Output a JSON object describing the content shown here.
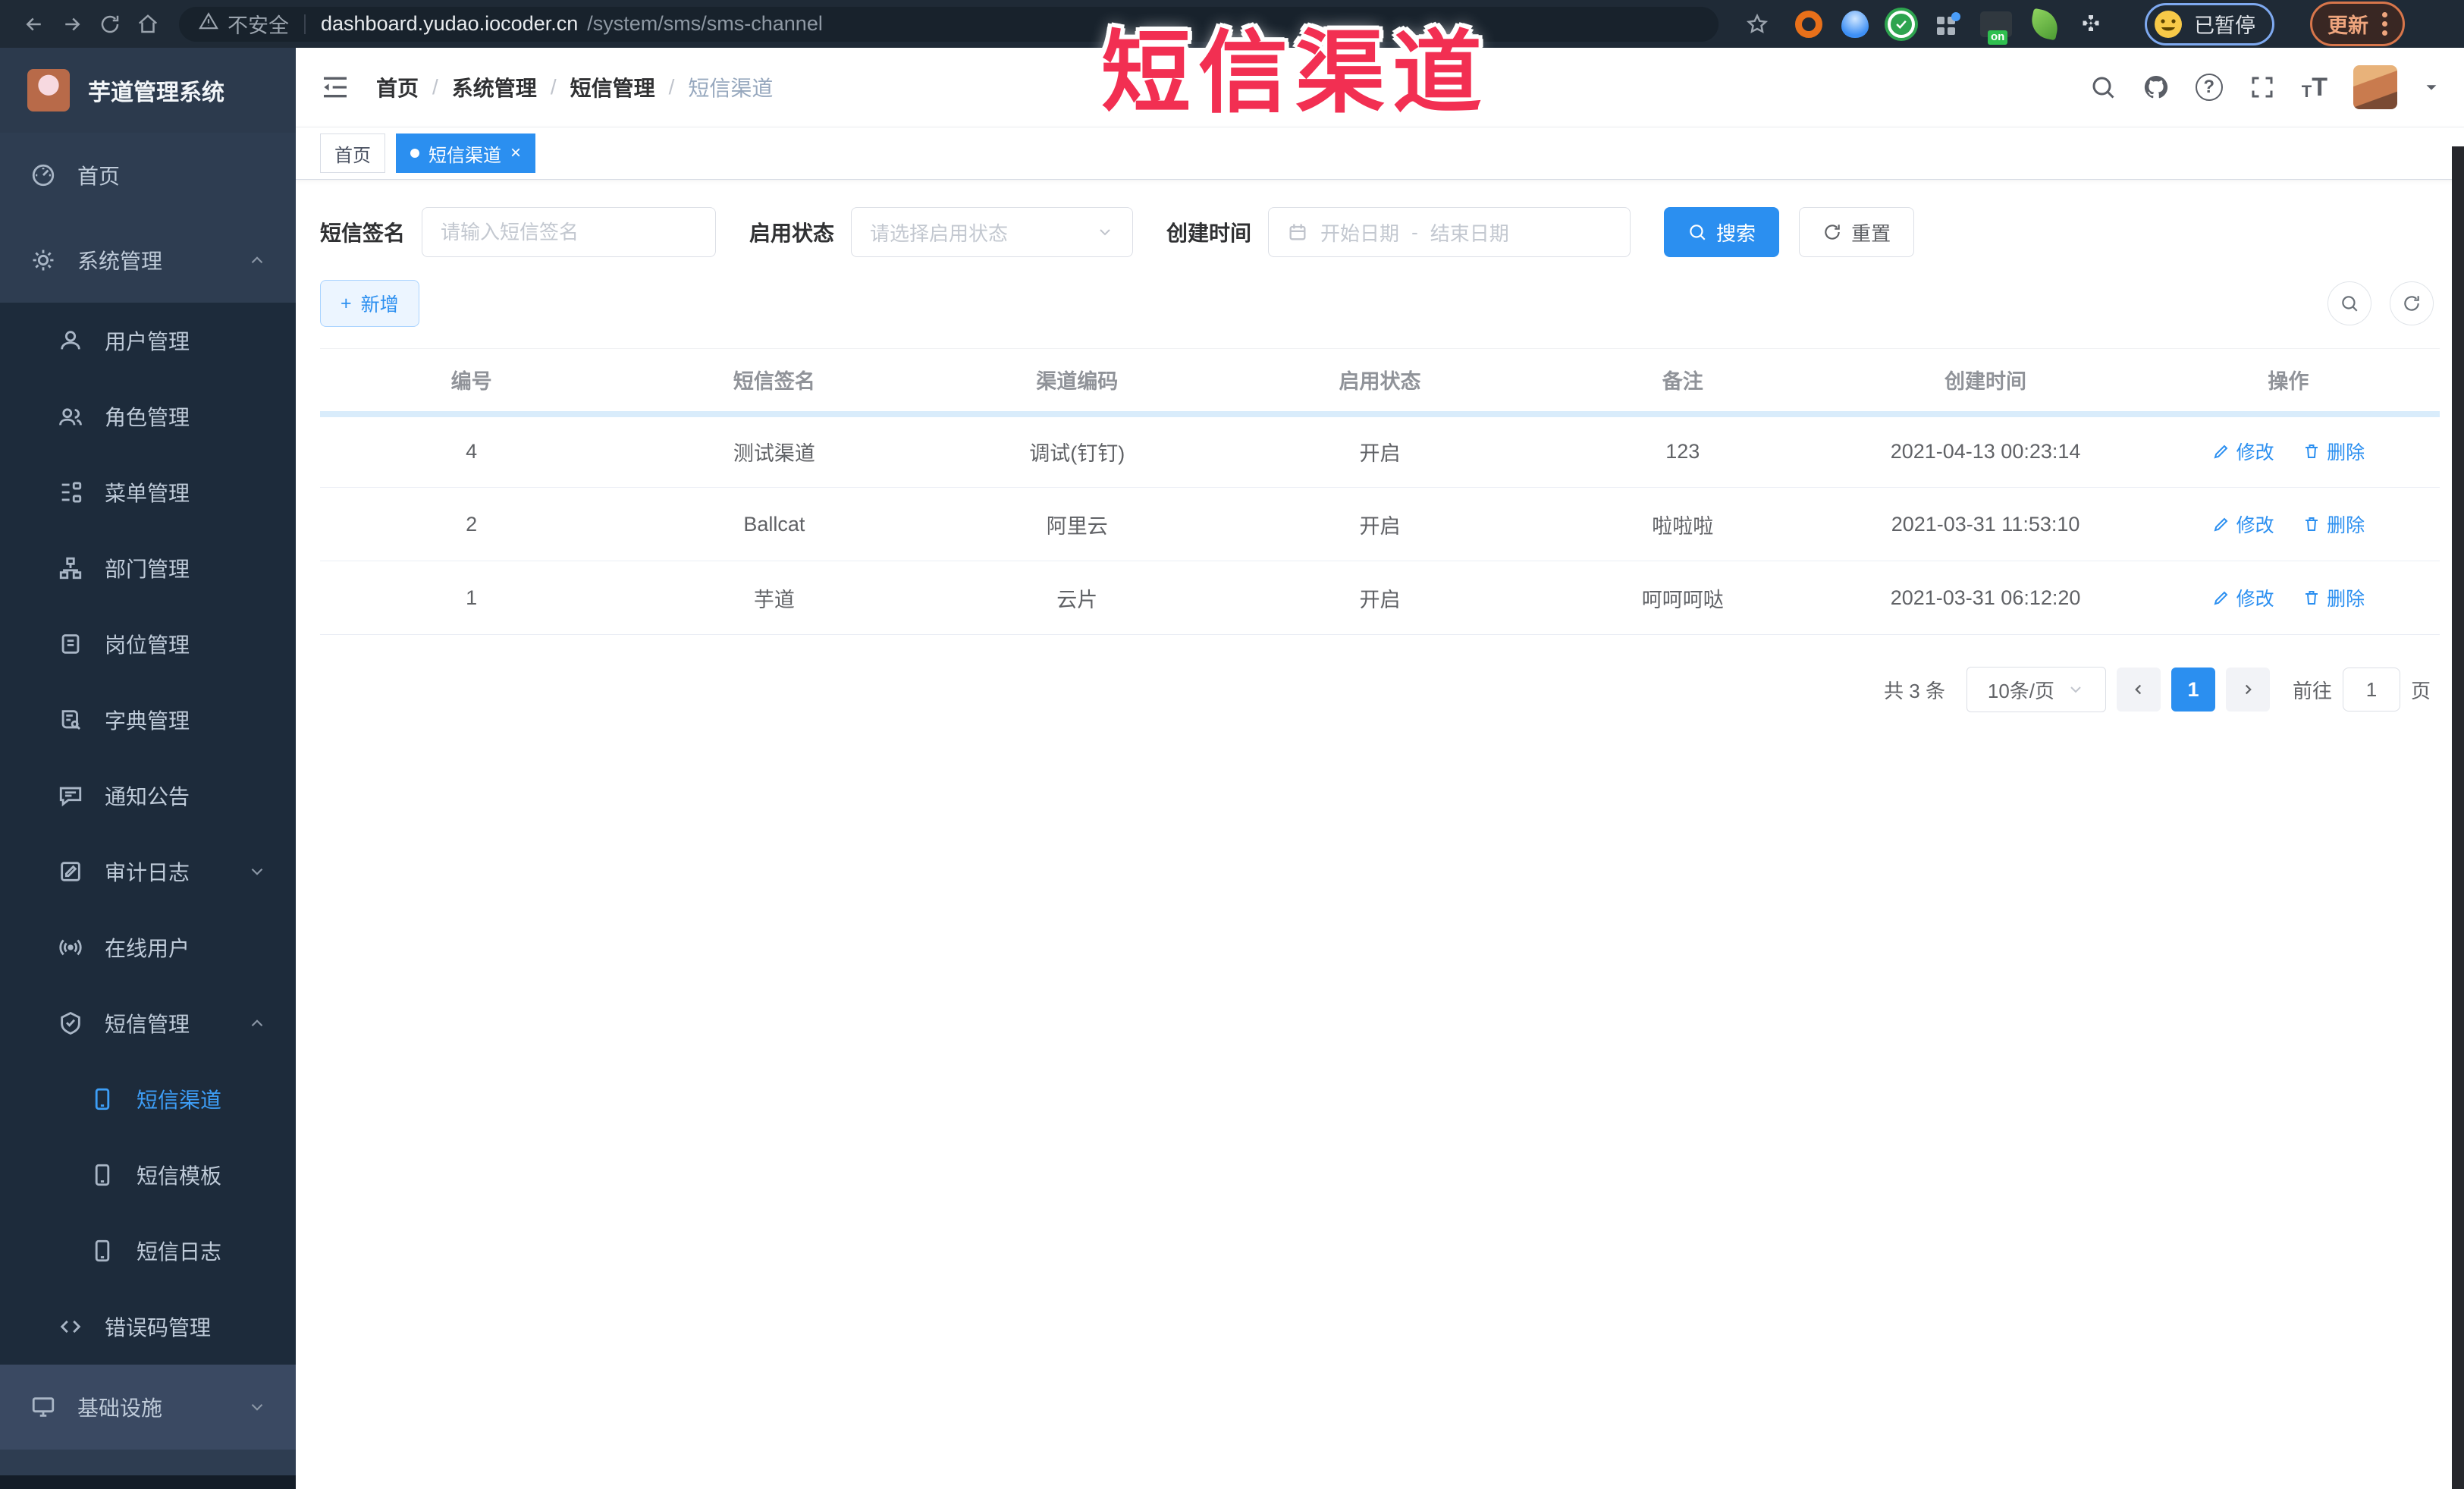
{
  "browser": {
    "security_label": "不安全",
    "url_host": "dashboard.yudao.iocoder.cn",
    "url_path": "/system/sms/sms-channel",
    "ext_on_label": "on",
    "paused_badge": "已暂停",
    "update_button": "更新"
  },
  "overlay": {
    "stamp": "短信渠道"
  },
  "sidebar": {
    "title": "芋道管理系统",
    "items": [
      {
        "label": "首页"
      },
      {
        "label": "系统管理"
      },
      {
        "label": "用户管理"
      },
      {
        "label": "角色管理"
      },
      {
        "label": "菜单管理"
      },
      {
        "label": "部门管理"
      },
      {
        "label": "岗位管理"
      },
      {
        "label": "字典管理"
      },
      {
        "label": "通知公告"
      },
      {
        "label": "审计日志"
      },
      {
        "label": "在线用户"
      },
      {
        "label": "短信管理"
      },
      {
        "label": "短信渠道"
      },
      {
        "label": "短信模板"
      },
      {
        "label": "短信日志"
      },
      {
        "label": "错误码管理"
      },
      {
        "label": "基础设施"
      }
    ]
  },
  "header": {
    "breadcrumb": [
      "首页",
      "系统管理",
      "短信管理",
      "短信渠道"
    ],
    "separator": "/"
  },
  "tags": [
    {
      "label": "首页"
    },
    {
      "label": "短信渠道",
      "close": "×"
    }
  ],
  "filters": {
    "sign_label": "短信签名",
    "sign_placeholder": "请输入短信签名",
    "status_label": "启用状态",
    "status_placeholder": "请选择启用状态",
    "time_label": "创建时间",
    "start_placeholder": "开始日期",
    "range_separator": "-",
    "end_placeholder": "结束日期",
    "search_label": "搜索",
    "reset_label": "重置"
  },
  "toolbar": {
    "add_label": "新增",
    "add_plus": "+"
  },
  "table": {
    "columns": [
      "编号",
      "短信签名",
      "渠道编码",
      "启用状态",
      "备注",
      "创建时间",
      "操作"
    ],
    "rows": [
      {
        "id": "4",
        "sign": "测试渠道",
        "code": "调试(钉钉)",
        "status": "开启",
        "remark": "123",
        "created": "2021-04-13 00:23:14"
      },
      {
        "id": "2",
        "sign": "Ballcat",
        "code": "阿里云",
        "status": "开启",
        "remark": "啦啦啦",
        "created": "2021-03-31 11:53:10"
      },
      {
        "id": "1",
        "sign": "芋道",
        "code": "云片",
        "status": "开启",
        "remark": "呵呵呵哒",
        "created": "2021-03-31 06:12:20"
      }
    ],
    "edit_label": "修改",
    "delete_label": "删除"
  },
  "pagination": {
    "total": "共 3 条",
    "page_size": "10条/页",
    "current": "1",
    "goto_label": "前往",
    "goto_value": "1",
    "page_unit": "页"
  },
  "colors": {
    "accent": "#2b8ff0",
    "sidebar": "#2e3d51",
    "submenu": "#1d2b3b",
    "stamp": "#f22f52"
  }
}
